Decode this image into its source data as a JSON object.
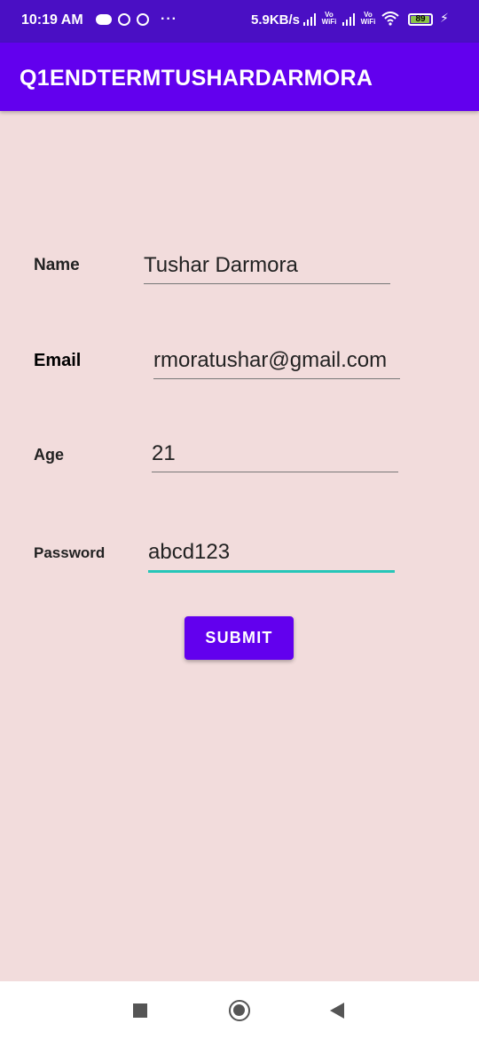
{
  "status_bar": {
    "time": "10:19 AM",
    "dots": "···",
    "network_speed": "5.9KB/s",
    "vowifi_1": "Vo WiFi",
    "vowifi_2": "Vo WiFi",
    "battery": "89"
  },
  "app_bar": {
    "title": "Q1ENDTERMTUSHARDARMORA"
  },
  "form": {
    "name_label": "Name",
    "name_value": "Tushar Darmora",
    "email_label": "Email",
    "email_value": "rmoratushar@gmail.com",
    "age_label": "Age",
    "age_value": "21",
    "password_label": "Password",
    "password_value": "abcd123",
    "submit_label": "SUBMIT"
  },
  "colors": {
    "status_bar": "#4a0fc4",
    "app_bar": "#6200ee",
    "background": "#f2dcdc",
    "focus_underline": "#26c6b8"
  }
}
